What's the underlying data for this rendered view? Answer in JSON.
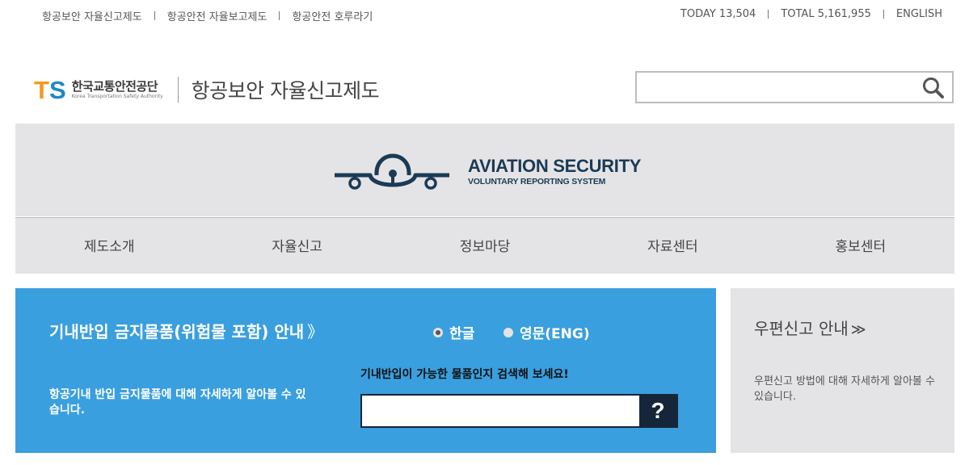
{
  "top_links": {
    "left": [
      "항공보안 자율신고제도",
      "항공안전 자율보고제도",
      "항공안전 호루라기"
    ],
    "today": "TODAY 13,504",
    "total": "TOTAL 5,161,955",
    "english": "ENGLISH"
  },
  "header": {
    "logo_mark_t": "T",
    "logo_mark_s": "S",
    "org_name_ko": "한국교통안전공단",
    "org_name_en": "Korea Transportation Safety Authority",
    "site_title": "항공보안 자율신고제도",
    "search": {
      "value": "",
      "placeholder": ""
    },
    "search_icon": "search-icon"
  },
  "banner": {
    "title_line1": "AVIATION SECURITY",
    "title_line2": "VOLUNTARY REPORTING SYSTEM",
    "colors": {
      "navy": "#1b3a55",
      "background": "#e4e4e6"
    }
  },
  "nav": {
    "items": [
      "제도소개",
      "자율신고",
      "정보마당",
      "자료센터",
      "홍보센터"
    ]
  },
  "prohibited": {
    "title": "기내반입 금지물품(위험물 포함) 안내",
    "title_chevron": "》",
    "lang_options": [
      {
        "label": "한글",
        "selected": true
      },
      {
        "label": "영문(ENG)",
        "selected": false
      }
    ],
    "description": "항공기내 반입 금지물품에 대해 자세하게 알아볼 수 있습니다.",
    "search_label": "기내반입이 가능한 물품인지 검색해 보세요!",
    "search": {
      "value": "",
      "placeholder": ""
    },
    "search_button": "?",
    "colors": {
      "panel": "#3a9fde",
      "button": "#15263a"
    }
  },
  "mail_report": {
    "title": "우편신고 안내",
    "title_chevron": "≫",
    "description": "우편신고 방법에 대해 자세하게 알아볼 수 있습니다."
  }
}
